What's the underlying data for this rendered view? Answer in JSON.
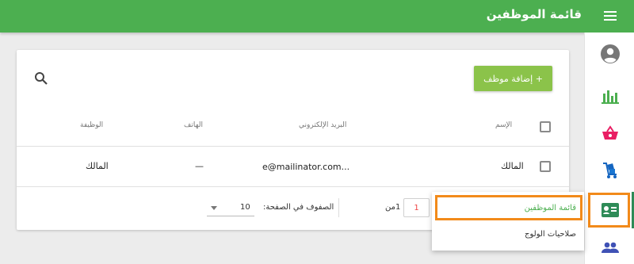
{
  "header": {
    "title": "قائمة الموظفين"
  },
  "toolbar": {
    "add_label": "+ إضافة موظف"
  },
  "table": {
    "columns": {
      "name": "الإسم",
      "email": "البريد الإلكتروني",
      "phone": "الهاتف",
      "job": "الوظيفة"
    },
    "rows": [
      {
        "name": "المالك",
        "email": "e@mailinator.com...",
        "phone": "—",
        "job": "المالك"
      }
    ]
  },
  "pagination": {
    "page_value": "1",
    "of_label": "1من",
    "rows_per_page_label": "الصفوف في الصفحة:",
    "rows_per_page_value": "10"
  },
  "menu": {
    "items": [
      {
        "label": "قائمة الموظفين",
        "color": "#4caf50"
      },
      {
        "label": "صلاحيات الولوج",
        "color": "#333333"
      }
    ]
  },
  "colors": {
    "primary": "#4caf50",
    "accent": "#8bc34a",
    "highlight": "#f28a1a"
  },
  "sidebar_icons": [
    "user-circle-icon",
    "bar-chart-icon",
    "basket-icon",
    "cart-icon",
    "id-card-icon",
    "group-icon"
  ]
}
